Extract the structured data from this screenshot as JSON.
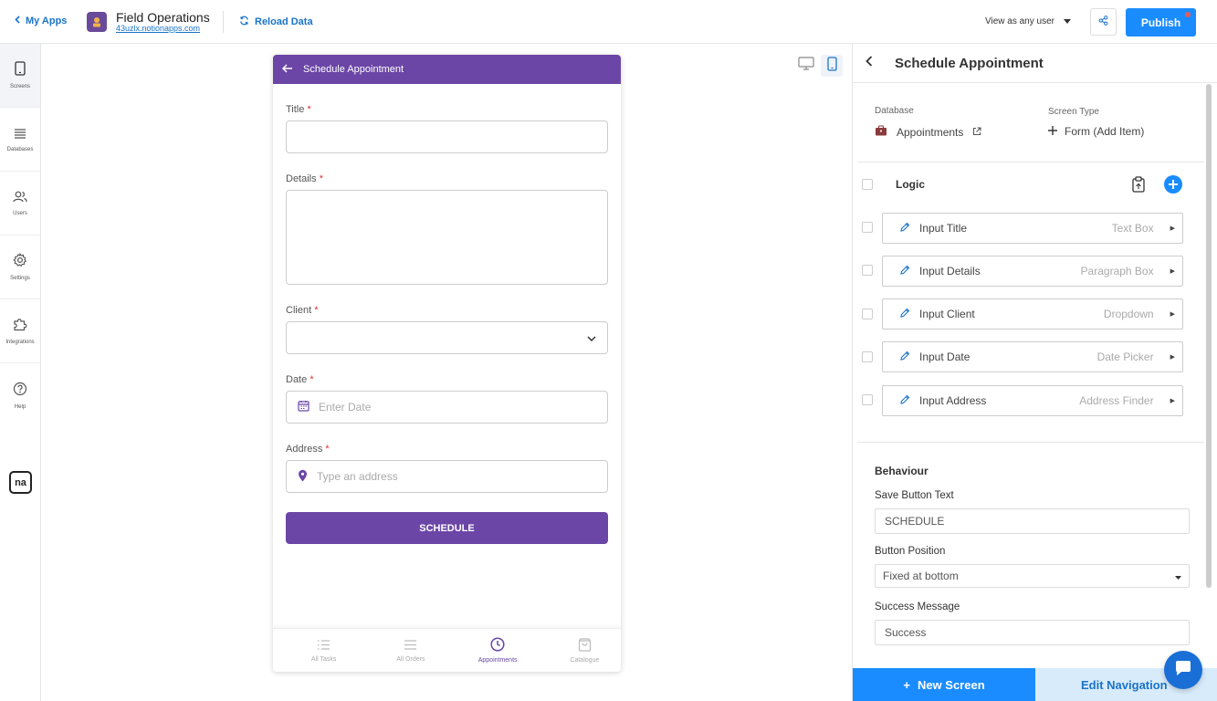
{
  "topbar": {
    "my_apps": "My Apps",
    "app_name": "Field Operations",
    "app_url": "43uzlx.notionapps.com",
    "reload": "Reload Data",
    "view_as": "View as any user",
    "publish": "Publish"
  },
  "sidebar": {
    "items": [
      {
        "label": "Screens",
        "icon": "phone-icon"
      },
      {
        "label": "Databases",
        "icon": "list-icon"
      },
      {
        "label": "Users",
        "icon": "users-icon"
      },
      {
        "label": "Settings",
        "icon": "gear-icon"
      },
      {
        "label": "Integrations",
        "icon": "puzzle-icon"
      },
      {
        "label": "Help",
        "icon": "help-icon"
      }
    ],
    "logo": "na"
  },
  "preview": {
    "header_title": "Schedule Appointment",
    "fields": {
      "title_label": "Title",
      "details_label": "Details",
      "client_label": "Client",
      "date_label": "Date",
      "date_placeholder": "Enter Date",
      "address_label": "Address",
      "address_placeholder": "Type an address",
      "required_mark": "*"
    },
    "submit": "SCHEDULE",
    "tabs": [
      {
        "label": "All Tasks",
        "active": false
      },
      {
        "label": "All Orders",
        "active": false
      },
      {
        "label": "Appointments",
        "active": true
      },
      {
        "label": "Catalogue",
        "active": false
      }
    ]
  },
  "panel": {
    "title": "Schedule Appointment",
    "database_label": "Database",
    "database_value": "Appointments",
    "screen_type_label": "Screen Type",
    "screen_type_value": "Form (Add Item)",
    "logic_label": "Logic",
    "items": [
      {
        "name": "Input Title",
        "type": "Text Box"
      },
      {
        "name": "Input Details",
        "type": "Paragraph Box"
      },
      {
        "name": "Input Client",
        "type": "Dropdown"
      },
      {
        "name": "Input Date",
        "type": "Date Picker"
      },
      {
        "name": "Input Address",
        "type": "Address Finder"
      }
    ],
    "behaviour": {
      "heading": "Behaviour",
      "save_label": "Save Button Text",
      "save_value": "SCHEDULE",
      "position_label": "Button Position",
      "position_value": "Fixed at bottom",
      "success_label": "Success Message",
      "success_value": "Success"
    },
    "new_screen": "New Screen",
    "new_screen_plus": "+",
    "edit_nav": "Edit Navigation"
  },
  "colors": {
    "accent": "#1a8cff",
    "brand_purple": "#6b46a6",
    "link": "#1a73c8"
  }
}
